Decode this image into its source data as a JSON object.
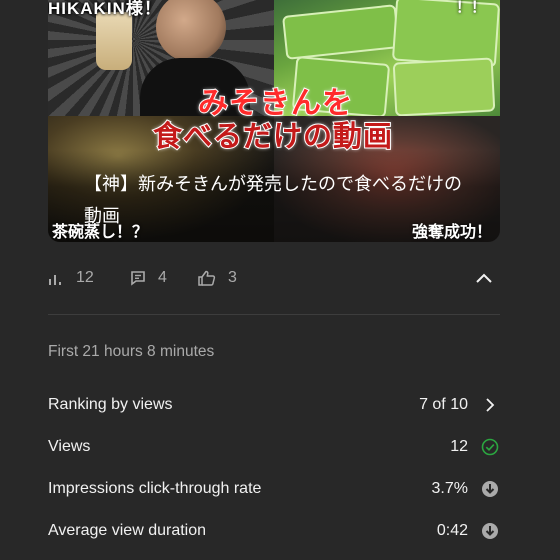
{
  "thumbnail": {
    "top_caption": "HIKAKIN様！",
    "top_caption_right": "！！",
    "banner_line1": "みそきんを",
    "banner_line2": "食べるだけの動画",
    "corner_left": "茶碗蒸し！？",
    "corner_right": "強奪成功！"
  },
  "video": {
    "title": "【神】新みそきんが発売したので食べるだけの動画"
  },
  "stats": {
    "views": "12",
    "comments": "4",
    "likes": "3"
  },
  "period_label": "First 21 hours 8 minutes",
  "metrics": [
    {
      "label": "Ranking by views",
      "value": "7 of 10",
      "icon": "chevron-right-icon"
    },
    {
      "label": "Views",
      "value": "12",
      "icon": "check-circle-icon"
    },
    {
      "label": "Impressions click-through rate",
      "value": "3.7%",
      "icon": "down-arrow-circle-icon"
    },
    {
      "label": "Average view duration",
      "value": "0:42",
      "icon": "down-arrow-circle-icon"
    }
  ],
  "colors": {
    "background": "#282828",
    "muted_text": "#aaaaaa",
    "primary_text": "#f1f1f1",
    "success_green": "#2ba640",
    "neutral_icon": "#aaaaaa"
  }
}
